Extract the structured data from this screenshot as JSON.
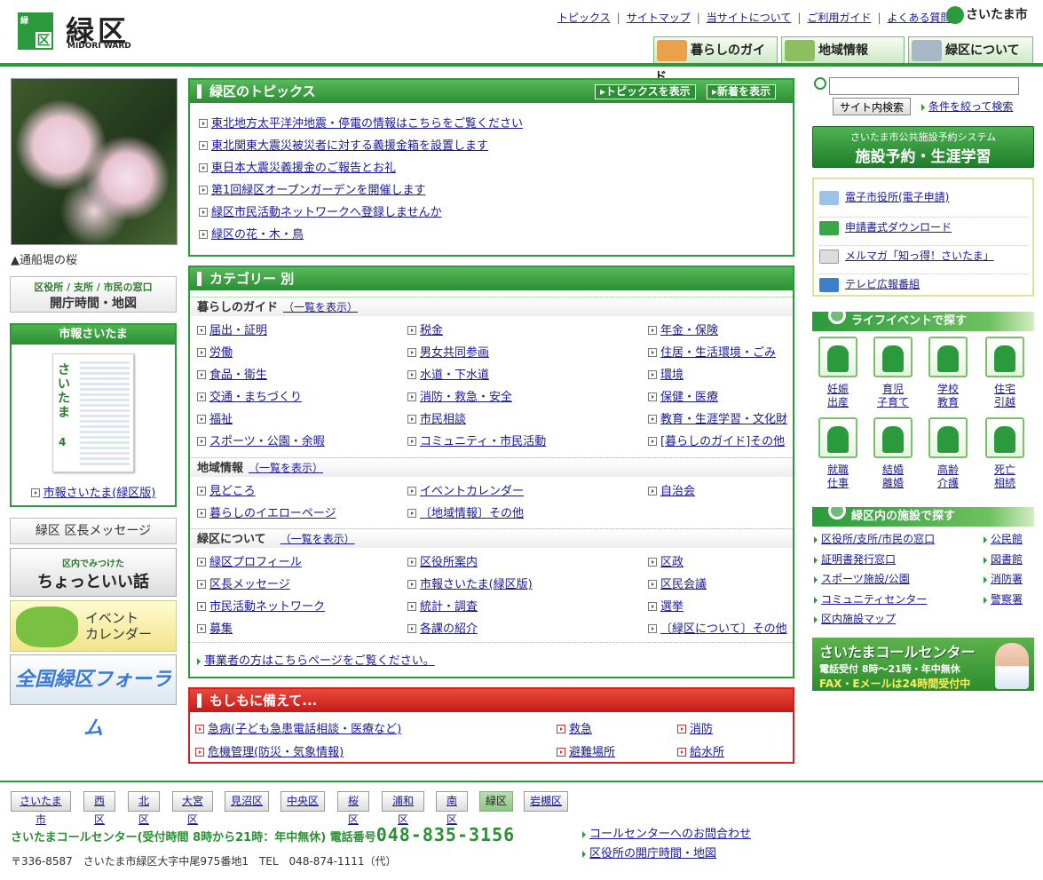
{
  "header": {
    "logo_small": "緑",
    "logo_box": "区",
    "ward_name": "緑区",
    "ward_en": "MIDORI WARD",
    "top_links": [
      "トピックス",
      "サイトマップ",
      "当サイトについて",
      "ご利用ガイド",
      "よくある質問"
    ],
    "city_logo": "さいたま市",
    "tabs": [
      "暮らしのガイド",
      "地域情報",
      "緑区について"
    ]
  },
  "left": {
    "photo_caption": "▲通船堀の桜",
    "hours_small": "区役所 / 支所 / 市民の窓口",
    "hours_main": "開庁時間・地図",
    "shiho_title": "市報さいたま",
    "shiho_cover_text": "さいたま",
    "shiho_cover_num": "4",
    "shiho_link": "市報さいたま(緑区版)",
    "mayor_message": "緑区 区長メッセージ",
    "choto_small": "区内でみつけた",
    "choto_main": "ちょっといい話",
    "event_line1": "イベント",
    "event_line2": "カレンダー",
    "forum": "全国緑区フォーラム"
  },
  "topics": {
    "title": "緑区のトピックス",
    "btn_show": "トピックスを表示",
    "btn_new": "新着を表示",
    "items": [
      "東北地方太平洋沖地震・停電の情報はこちらをご覧ください",
      "東北関東大震災被災者に対する義援金箱を設置します",
      "東日本大震災義援金のご報告とお礼",
      "第1回緑区オープンガーデンを開催します",
      "緑区市民活動ネットワークへ登録しませんか",
      "緑区の花・木・鳥"
    ]
  },
  "category": {
    "title": "カテゴリー 別",
    "list_link": "（一覧を表示）",
    "sections": [
      {
        "title": "暮らしのガイド",
        "items": [
          "届出・証明",
          "税金",
          "年金・保険",
          "労働",
          "男女共同参画",
          "住居・生活環境・ごみ",
          "食品・衛生",
          "水道・下水道",
          "環境",
          "交通・まちづくり",
          "消防・救急・安全",
          "保健・医療",
          "福祉",
          "市民相談",
          "教育・生涯学習・文化財",
          "スポーツ・公園・余暇",
          "コミュニティ・市民活動",
          "[暮らしのガイド]その他"
        ]
      },
      {
        "title": "地域情報",
        "items": [
          "見どころ",
          "イベントカレンダー",
          "自治会",
          "暮らしのイエローページ",
          "〔地域情報〕その他"
        ]
      },
      {
        "title": "緑区について",
        "items": [
          "緑区プロフィール",
          "区役所案内",
          "区政",
          "区長メッセージ",
          "市報さいたま(緑区版)",
          "区民会議",
          "市民活動ネットワーク",
          "統計・調査",
          "選挙",
          "募集",
          "各課の紹介",
          "〔緑区について〕その他"
        ]
      }
    ],
    "business": "事業者の方はこちらページをご覧ください。"
  },
  "emergency": {
    "title": "もしもに備えて...",
    "items": [
      "急病(子ども急患電話相談・医療など)",
      "救急",
      "消防",
      "危機管理(防災・気象情報)",
      "避難場所",
      "給水所"
    ]
  },
  "right": {
    "search_placeholder": "",
    "search_btn": "サイト内検索",
    "adv_search": "条件を絞って検索",
    "facility_small": "さいたま市公共施設予約システム",
    "facility_main": "施設予約・生涯学習",
    "elinks": [
      "電子市役所(電子申請)",
      "申請書式ダウンロード",
      "メルマガ「知っ得！さいたま」",
      "テレビ広報番組"
    ],
    "life_title": "ライフイベントで探す",
    "life": [
      [
        "妊娠",
        "出産"
      ],
      [
        "育児",
        "子育て"
      ],
      [
        "学校",
        "教育"
      ],
      [
        "住宅",
        "引越"
      ],
      [
        "就職",
        "仕事"
      ],
      [
        "結婚",
        "離婚"
      ],
      [
        "高齢",
        "介護"
      ],
      [
        "死亡",
        "相続"
      ]
    ],
    "fac_title": "緑区内の施設で探す",
    "facilities": [
      "区役所/支所/市民の窓口",
      "公民館",
      "証明書発行窓口",
      "図書館",
      "スポーツ施設/公園",
      "消防署",
      "コミュニティセンター",
      "警察署",
      "区内施設マップ"
    ],
    "callc_main": "さいたまコールセンター",
    "callc_s1": "電話受付 8時～21時・年中無休",
    "callc_s2": "FAX・Eメールは24時間受付中"
  },
  "footer": {
    "wards": [
      "さいたま市",
      "西区",
      "北区",
      "大宮区",
      "見沼区",
      "中央区",
      "桜区",
      "浦和区",
      "南区",
      "緑区",
      "岩槻区"
    ],
    "call_label": "さいたまコールセンター(受付時間 8時から21時：年中無休) 電話番号",
    "call_number": "048-835-3156",
    "address": "〒336-8587　さいたま市緑区大字中尾975番地1　TEL　048-874-1111（代）",
    "link1": "コールセンターへのお問合わせ",
    "link2": "区役所の開庁時間・地図"
  },
  "colors": {
    "brand_green": "#2b9a3d",
    "alert_red": "#d42020",
    "link": "#1a1a99"
  }
}
